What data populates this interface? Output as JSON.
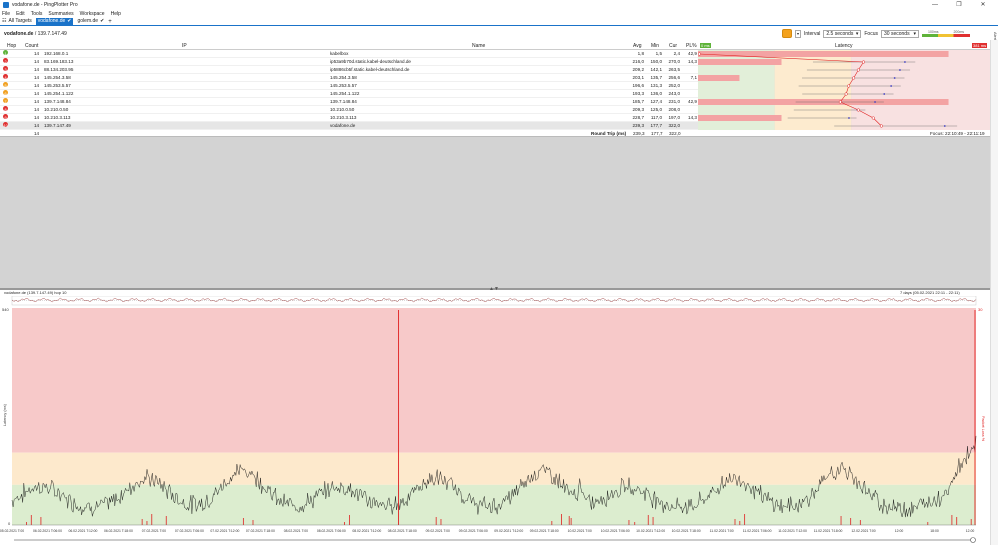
{
  "window": {
    "title": "vodafone.de - PingPlotter Pro",
    "minimize_glyph": "—",
    "maximize_glyph": "❐",
    "close_glyph": "✕"
  },
  "menu": [
    "File",
    "Edit",
    "Tools",
    "Summaries",
    "Workspace",
    "Help"
  ],
  "tabs": [
    {
      "label": "All Targets",
      "active": false
    },
    {
      "label": "vodafone.de",
      "active": true
    },
    {
      "label": "golem.de",
      "active": false
    }
  ],
  "add_tab": "+",
  "breadcrumb": {
    "name": "vodafone.de",
    "separator": " / ",
    "ip": "139.7.147.49"
  },
  "controls": {
    "interval_label": "Interval",
    "interval_value": "2.5 seconds",
    "focus_label": "Focus",
    "focus_value": "30 seconds",
    "scale_labels": [
      "100ms",
      "200ms"
    ],
    "alerts_label": "Alerts"
  },
  "table": {
    "columns": [
      "Hop",
      "Count",
      "IP",
      "Name",
      "Avg",
      "Min",
      "Cur",
      "PL%",
      "0 ms",
      "Latency",
      "381 ms"
    ],
    "rows": [
      {
        "hop": "1",
        "status": "#5fb33a",
        "count": "14",
        "ip": "192.168.0.1",
        "name": "kabelbox",
        "avg": "1,8",
        "min": "1,5",
        "cur": "2,4",
        "pl": "42,9"
      },
      {
        "hop": "2",
        "status": "#e03030",
        "count": "14",
        "ip": "83.169.183.13",
        "name": "ip53a9b70d.static.kabel-deutschland.de",
        "avg": "216,0",
        "min": "150,0",
        "cur": "270,0",
        "pl": "14,3"
      },
      {
        "hop": "3",
        "status": "#e03030",
        "count": "14",
        "ip": "88.134.203.95",
        "name": "ip5886cb5f.static.kabel-deutschland.de",
        "avg": "209,2",
        "min": "142,1",
        "cur": "263,5",
        "pl": ""
      },
      {
        "hop": "4",
        "status": "#e03030",
        "count": "14",
        "ip": "145.254.3.58",
        "name": "145.254.3.58",
        "avg": "203,1",
        "min": "135,7",
        "cur": "256,6",
        "pl": "7,1"
      },
      {
        "hop": "5",
        "status": "#f1a020",
        "count": "14",
        "ip": "145.253.5.57",
        "name": "145.253.5.57",
        "avg": "196,6",
        "min": "131,3",
        "cur": "252,0",
        "pl": ""
      },
      {
        "hop": "6",
        "status": "#f1a020",
        "count": "14",
        "ip": "145.254.1.122",
        "name": "145.254.1.122",
        "avg": "193,3",
        "min": "136,0",
        "cur": "243,0",
        "pl": ""
      },
      {
        "hop": "7",
        "status": "#f1a020",
        "count": "14",
        "ip": "139.7.148.84",
        "name": "139.7.148.84",
        "avg": "185,7",
        "min": "127,4",
        "cur": "231,0",
        "pl": "42,9"
      },
      {
        "hop": "8",
        "status": "#e03030",
        "count": "14",
        "ip": "10.210.0.50",
        "name": "10.210.0.50",
        "avg": "209,3",
        "min": "125,0",
        "cur": "208,0",
        "pl": ""
      },
      {
        "hop": "9",
        "status": "#e03030",
        "count": "14",
        "ip": "10.210.3.113",
        "name": "10.210.3.113",
        "avg": "228,7",
        "min": "117,0",
        "cur": "197,0",
        "pl": "14,3"
      },
      {
        "hop": "10",
        "status": "#e03030",
        "count": "14",
        "ip": "139.7.147.49",
        "name": "vodafone.de",
        "avg": "239,3",
        "min": "177,7",
        "cur": "322,0",
        "pl": ""
      }
    ],
    "summary": {
      "count": "14",
      "label": "Round Trip (ms)",
      "avg": "239,3",
      "min": "177,7",
      "cur": "322,0",
      "focus": "Focus: 22:10:49 - 22:11:19"
    }
  },
  "timeline": {
    "title": "vodafone.de (139.7.147.49) hop 10",
    "range": "7 days (05.02.2021 22:11 - 22:11)",
    "ylabel": "Latency (ms)",
    "yaxis_right": "Packet Loss %",
    "ymax_left": "540",
    "ymax_right": "30",
    "xlabels": [
      "05.02.2021 T:00",
      "06.02.2021 T:06:00",
      "06.02.2021 T:12:00",
      "06.02.2021 T:18:00",
      "07.02.2021 T:00",
      "07.02.2021 T:06:00",
      "07.02.2021 T:12:00",
      "07.02.2021 T:18:00",
      "08.02.2021 T:00",
      "08.02.2021 T:06:00",
      "08.02.2021 T:12:00",
      "08.02.2021 T:18:00",
      "09.02.2021 T:00",
      "09.02.2021 T:06:00",
      "09.02.2021 T:12:00",
      "09.02.2021 T:18:00",
      "10.02.2021 T:00",
      "10.02.2021 T:06:00",
      "10.02.2021 T:12:00",
      "10.02.2021 T:18:00",
      "11.02.2021 T:00",
      "11.02.2021 T:06:00",
      "11.02.2021 T:12:00",
      "11.02.2021 T:18:00",
      "12.02.2021 T:00",
      "12:00",
      "18:00",
      "12.00"
    ]
  },
  "colors": {
    "accent": "#1a73c9",
    "good": "#d8ecc8",
    "warn": "#fde8c8",
    "bad": "#f7c6c6",
    "line": "#111111",
    "loss": "#e02020"
  }
}
